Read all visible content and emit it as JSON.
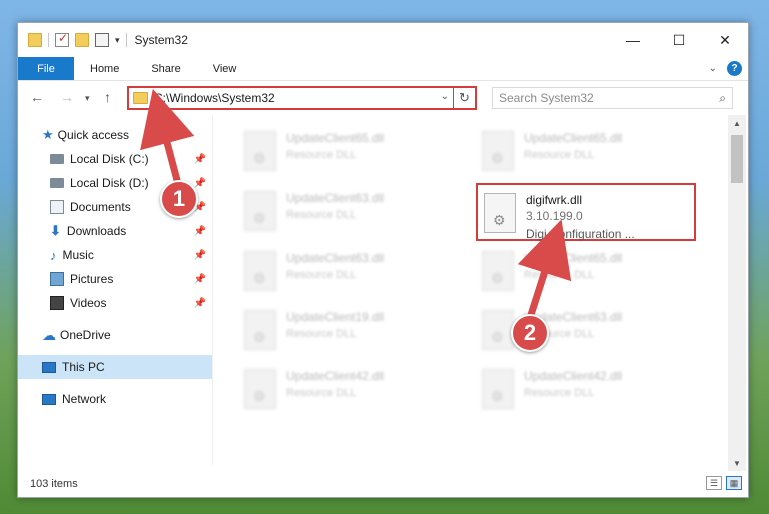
{
  "window": {
    "title": "System32",
    "controls": {
      "minimize": "—",
      "maximize": "☐",
      "close": "✕"
    }
  },
  "ribbon": {
    "tabs": [
      "File",
      "Home",
      "Share",
      "View"
    ]
  },
  "nav": {
    "address": "C:\\Windows\\System32",
    "search_placeholder": "Search System32"
  },
  "sidebar": {
    "items": [
      {
        "label": "Quick access"
      },
      {
        "label": "Local Disk (C:)"
      },
      {
        "label": "Local Disk (D:)"
      },
      {
        "label": "Documents"
      },
      {
        "label": "Downloads"
      },
      {
        "label": "Music"
      },
      {
        "label": "Pictures"
      },
      {
        "label": "Videos"
      },
      {
        "label": "OneDrive"
      },
      {
        "label": "This PC"
      },
      {
        "label": "Network"
      }
    ]
  },
  "files": [
    {
      "name": "UpdateClient65.dll",
      "type": "Resource DLL"
    },
    {
      "name": "UpdateClient65.dll",
      "type": "Resource DLL"
    },
    {
      "name": "UpdateClient63.dll",
      "type": "Resource DLL"
    },
    {
      "name": "UpdateClient63.dll",
      "type": "Resource DLL"
    },
    {
      "name": "UpdateClient65.dll",
      "type": "Resource DLL"
    },
    {
      "name": "UpdateClient19.dll",
      "type": "Resource DLL"
    },
    {
      "name": "UpdateClient63.dll",
      "type": "Resource DLL"
    },
    {
      "name": "UpdateClient42.dll",
      "type": "Resource DLL"
    },
    {
      "name": "UpdateClient42.dll",
      "type": "Resource DLL"
    }
  ],
  "highlighted_file": {
    "name": "digifwrk.dll",
    "version": "3.10.199.0",
    "description": "Digi Configuration ..."
  },
  "status": {
    "count": "103 items"
  },
  "annotations": {
    "step1": "1",
    "step2": "2"
  },
  "colors": {
    "accent": "#1979ca",
    "highlight_red": "#d43c3c",
    "callout": "#d94a4a"
  }
}
